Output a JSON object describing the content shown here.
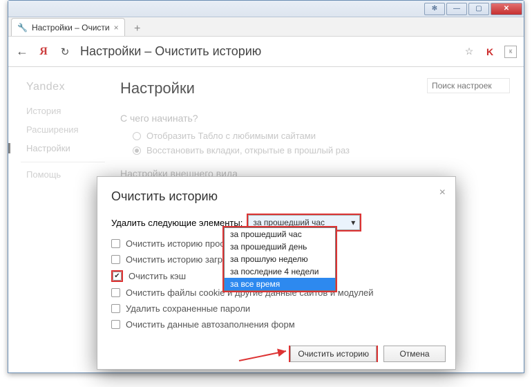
{
  "window": {
    "tab_title": "Настройки – Очисти",
    "url_text": "Настройки – Очистить историю"
  },
  "sidebar": {
    "brand": "Yandex",
    "items": [
      {
        "label": "История"
      },
      {
        "label": "Расширения"
      },
      {
        "label": "Настройки"
      },
      {
        "label": "Помощь"
      }
    ]
  },
  "page": {
    "title": "Настройки",
    "search_placeholder": "Поиск настроек",
    "section1": "С чего начинать?",
    "radio1": "Отобразить Табло с любимыми сайтами",
    "radio2": "Восстановить вкладки, открытые в прошлый раз",
    "section2": "Настройки внешнего вида"
  },
  "dialog": {
    "title": "Очистить историю",
    "remove_label": "Удалить следующие элементы:",
    "select_value": "за прошедший час",
    "options": [
      "за прошедший час",
      "за прошедший день",
      "за прошлую неделю",
      "за последние 4 недели",
      "за все время"
    ],
    "checkboxes": [
      "Очистить историю просмотров",
      "Очистить историю загрузок",
      "Очистить кэш",
      "Очистить файлы cookie и другие данные сайтов и модулей",
      "Удалить сохраненные пароли",
      "Очистить данные автозаполнения форм"
    ],
    "clear_btn": "Очистить историю",
    "cancel_btn": "Отмена"
  }
}
